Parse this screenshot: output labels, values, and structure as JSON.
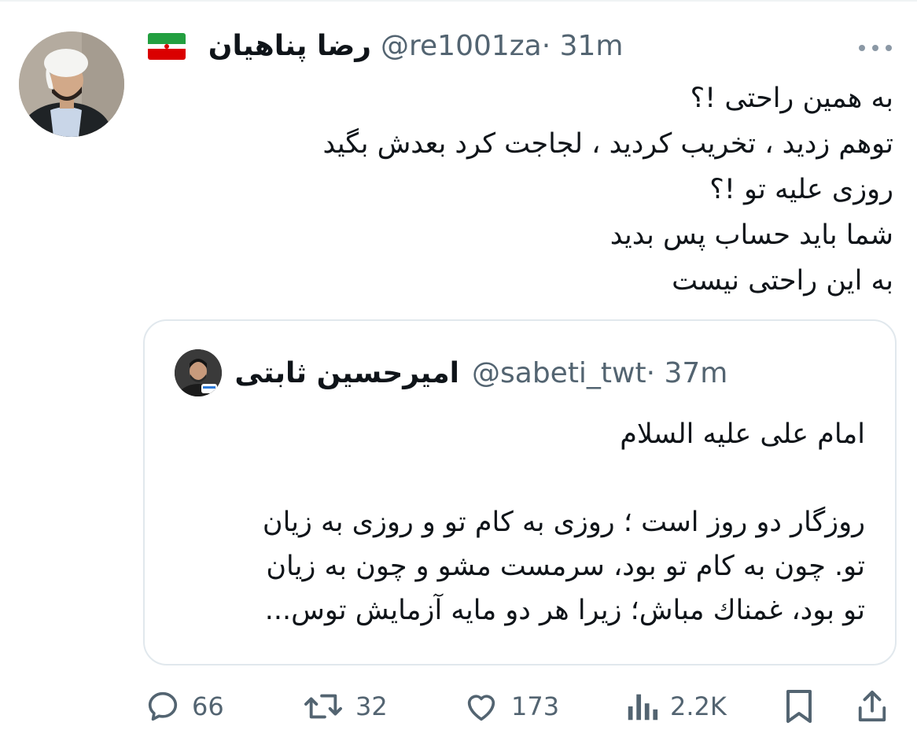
{
  "author": {
    "name": "رضا پناهیان",
    "handle": "@re1001za",
    "time": "· 31m",
    "flag": "iran-flag-icon"
  },
  "tweet": {
    "lines": [
      "به همین راحتی !؟",
      "توهم زدید ، تخریب کردید ، لجاجت کرد بعدش بگید",
      "روزی علیه تو !؟",
      "شما باید حساب پس بدید",
      "به این راحتی نیست"
    ]
  },
  "quote": {
    "name": "امیرحسین ثابتی",
    "handle": "@sabeti_twt",
    "time": "· 37m",
    "lines": [
      "امام علی علیه السلام",
      "",
      "روزگار دو روز است ؛ روزی به کام تو و روزی به زیان",
      "تو. چون به کام تو بود، سرمست مشو و چون به زیان",
      "تو بود، غمناك مباش؛ زیرا هر دو مایه آزمایش توس..."
    ]
  },
  "actions": {
    "replies": "66",
    "retweets": "32",
    "likes": "173",
    "views": "2.2K"
  },
  "colors": {
    "text": "#0f1419",
    "secondary": "#536471",
    "border": "#e1e8ed"
  }
}
